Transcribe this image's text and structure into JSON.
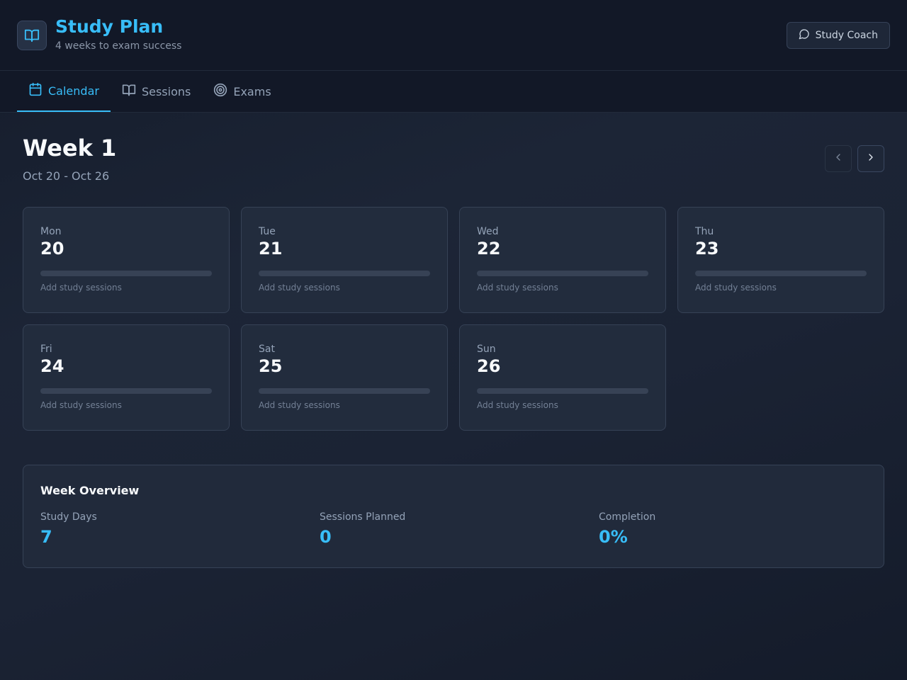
{
  "header": {
    "title": "Study Plan",
    "subtitle": "4 weeks to exam success",
    "coach_button": "Study Coach",
    "logo_icon": "open-book-icon"
  },
  "tabs": [
    {
      "label": "Calendar",
      "icon": "calendar-icon",
      "active": true
    },
    {
      "label": "Sessions",
      "icon": "open-book-icon",
      "active": false
    },
    {
      "label": "Exams",
      "icon": "target-icon",
      "active": false
    }
  ],
  "week": {
    "title": "Week 1",
    "range": "Oct 20 - Oct 26",
    "prev_icon": "chevron-left-icon",
    "next_icon": "chevron-right-icon"
  },
  "days": [
    {
      "name": "Mon",
      "date": "20",
      "hint": "Add study sessions",
      "progress": 0
    },
    {
      "name": "Tue",
      "date": "21",
      "hint": "Add study sessions",
      "progress": 0
    },
    {
      "name": "Wed",
      "date": "22",
      "hint": "Add study sessions",
      "progress": 0
    },
    {
      "name": "Thu",
      "date": "23",
      "hint": "Add study sessions",
      "progress": 0
    },
    {
      "name": "Fri",
      "date": "24",
      "hint": "Add study sessions",
      "progress": 0
    },
    {
      "name": "Sat",
      "date": "25",
      "hint": "Add study sessions",
      "progress": 0
    },
    {
      "name": "Sun",
      "date": "26",
      "hint": "Add study sessions",
      "progress": 0
    }
  ],
  "overview": {
    "title": "Week Overview",
    "stats": [
      {
        "label": "Study Days",
        "value": "7"
      },
      {
        "label": "Sessions Planned",
        "value": "0"
      },
      {
        "label": "Completion",
        "value": "0%"
      }
    ]
  },
  "colors": {
    "accent": "#38bdf8",
    "background": "#1c2536",
    "card": "#222c3d"
  }
}
